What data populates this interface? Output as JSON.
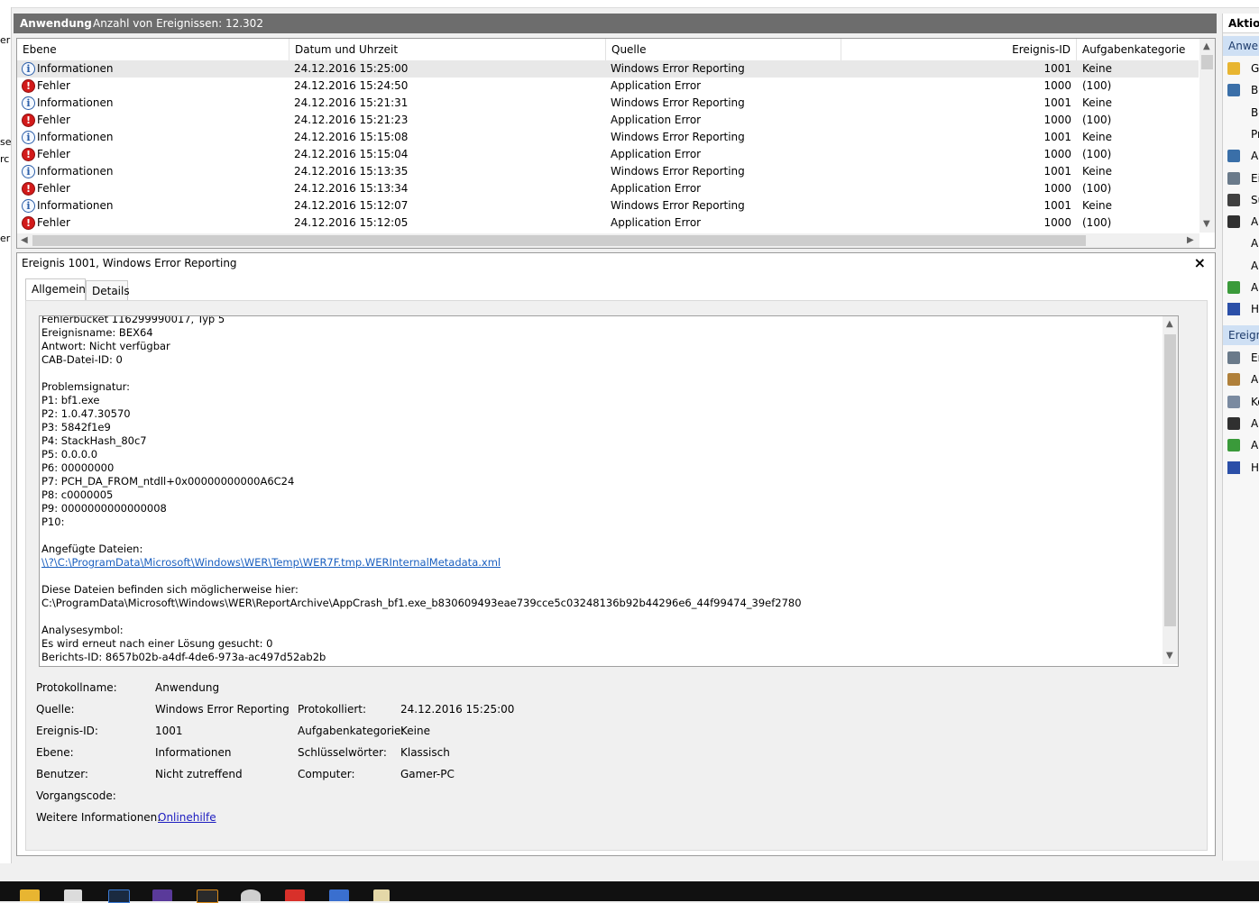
{
  "header": {
    "title": "Anwendung",
    "count_label": "Anzahl von Ereignissen: 12.302"
  },
  "left_strip": {
    "fragments": [
      "er",
      "se",
      "rc",
      "er"
    ]
  },
  "columns": [
    "Ebene",
    "Datum und Uhrzeit",
    "Quelle",
    "Ereignis-ID",
    "Aufgabenkategorie"
  ],
  "events": [
    {
      "level": "Informationen",
      "type": "info",
      "datetime": "24.12.2016 15:25:00",
      "source": "Windows Error Reporting",
      "id": "1001",
      "category": "Keine"
    },
    {
      "level": "Fehler",
      "type": "err",
      "datetime": "24.12.2016 15:24:50",
      "source": "Application Error",
      "id": "1000",
      "category": "(100)"
    },
    {
      "level": "Informationen",
      "type": "info",
      "datetime": "24.12.2016 15:21:31",
      "source": "Windows Error Reporting",
      "id": "1001",
      "category": "Keine"
    },
    {
      "level": "Fehler",
      "type": "err",
      "datetime": "24.12.2016 15:21:23",
      "source": "Application Error",
      "id": "1000",
      "category": "(100)"
    },
    {
      "level": "Informationen",
      "type": "info",
      "datetime": "24.12.2016 15:15:08",
      "source": "Windows Error Reporting",
      "id": "1001",
      "category": "Keine"
    },
    {
      "level": "Fehler",
      "type": "err",
      "datetime": "24.12.2016 15:15:04",
      "source": "Application Error",
      "id": "1000",
      "category": "(100)"
    },
    {
      "level": "Informationen",
      "type": "info",
      "datetime": "24.12.2016 15:13:35",
      "source": "Windows Error Reporting",
      "id": "1001",
      "category": "Keine"
    },
    {
      "level": "Fehler",
      "type": "err",
      "datetime": "24.12.2016 15:13:34",
      "source": "Application Error",
      "id": "1000",
      "category": "(100)"
    },
    {
      "level": "Informationen",
      "type": "info",
      "datetime": "24.12.2016 15:12:07",
      "source": "Windows Error Reporting",
      "id": "1001",
      "category": "Keine"
    },
    {
      "level": "Fehler",
      "type": "err",
      "datetime": "24.12.2016 15:12:05",
      "source": "Application Error",
      "id": "1000",
      "category": "(100)"
    }
  ],
  "detail": {
    "title": "Ereignis 1001, Windows Error Reporting",
    "close": "×",
    "tabs": [
      "Allgemein",
      "Details"
    ],
    "description": {
      "line_top": "Fehlerbucket 116299990017, Typ 5",
      "lines_a": [
        "Ereignisname: BEX64",
        "Antwort: Nicht verfügbar",
        "CAB-Datei-ID: 0",
        "",
        "Problemsignatur:",
        "P1: bf1.exe",
        "P2: 1.0.47.30570",
        "P3: 5842f1e9",
        "P4: StackHash_80c7",
        "P5: 0.0.0.0",
        "P6: 00000000",
        "P7: PCH_DA_FROM_ntdll+0x00000000000A6C24",
        "P8: c0000005",
        "P9: 0000000000000008",
        "P10:",
        "",
        "Angefügte Dateien:"
      ],
      "link": "\\\\?\\C:\\ProgramData\\Microsoft\\Windows\\WER\\Temp\\WER7F.tmp.WERInternalMetadata.xml",
      "lines_b": [
        "",
        "Diese Dateien befinden sich möglicherweise hier:",
        "C:\\ProgramData\\Microsoft\\Windows\\WER\\ReportArchive\\AppCrash_bf1.exe_b830609493eae739cce5c03248136b92b44296e6_44f99474_39ef2780",
        "",
        "Analysesymbol:",
        "Es wird erneut nach einer Lösung gesucht: 0",
        "Berichts-ID: 8657b02b-a4df-4de6-973a-ac497d52ab2b"
      ]
    },
    "fields": {
      "protokollname_label": "Protokollname:",
      "protokollname_value": "Anwendung",
      "quelle_label": "Quelle:",
      "quelle_value": "Windows Error Reporting",
      "protokolliert_label": "Protokolliert:",
      "protokolliert_value": "24.12.2016 15:25:00",
      "ereignisid_label": "Ereignis-ID:",
      "ereignisid_value": "1001",
      "aufgabe_label": "Aufgabenkategorie:",
      "aufgabe_value": "Keine",
      "ebene_label": "Ebene:",
      "ebene_value": "Informationen",
      "schluessel_label": "Schlüsselwörter:",
      "schluessel_value": "Klassisch",
      "benutzer_label": "Benutzer:",
      "benutzer_value": "Nicht zutreffend",
      "computer_label": "Computer:",
      "computer_value": "Gamer-PC",
      "vorgang_label": "Vorgangscode:",
      "weitere_label": "Weitere Informationen:",
      "weitere_link": "Onlinehilfe"
    }
  },
  "actions": {
    "header": "Aktion",
    "section1": "Anwer",
    "section1_items": [
      {
        "icon": "folder-open-icon",
        "text": "G"
      },
      {
        "icon": "filter-icon",
        "text": "Be"
      },
      {
        "icon": "",
        "text": "Be"
      },
      {
        "icon": "",
        "text": "Pr"
      },
      {
        "icon": "filter-icon",
        "text": "A"
      },
      {
        "icon": "properties-icon",
        "text": "Ei"
      },
      {
        "icon": "binoculars-icon",
        "text": "Su"
      },
      {
        "icon": "save-icon",
        "text": "A"
      },
      {
        "icon": "",
        "text": "A"
      },
      {
        "icon": "",
        "text": "A"
      },
      {
        "icon": "refresh-icon",
        "text": "A"
      },
      {
        "icon": "help-icon",
        "text": "H"
      }
    ],
    "section2": "Ereign",
    "section2_items": [
      {
        "icon": "properties-icon",
        "text": "Er"
      },
      {
        "icon": "task-clock-icon",
        "text": "A"
      },
      {
        "icon": "copy-icon",
        "text": "Ko"
      },
      {
        "icon": "save-icon",
        "text": "A"
      },
      {
        "icon": "refresh-icon",
        "text": "A"
      },
      {
        "icon": "help-icon",
        "text": "H"
      }
    ]
  },
  "colors": {
    "header_bg": "#6d6d6d",
    "link": "#1a5fbf",
    "error": "#d21a1a",
    "info": "#2b5ea8"
  }
}
